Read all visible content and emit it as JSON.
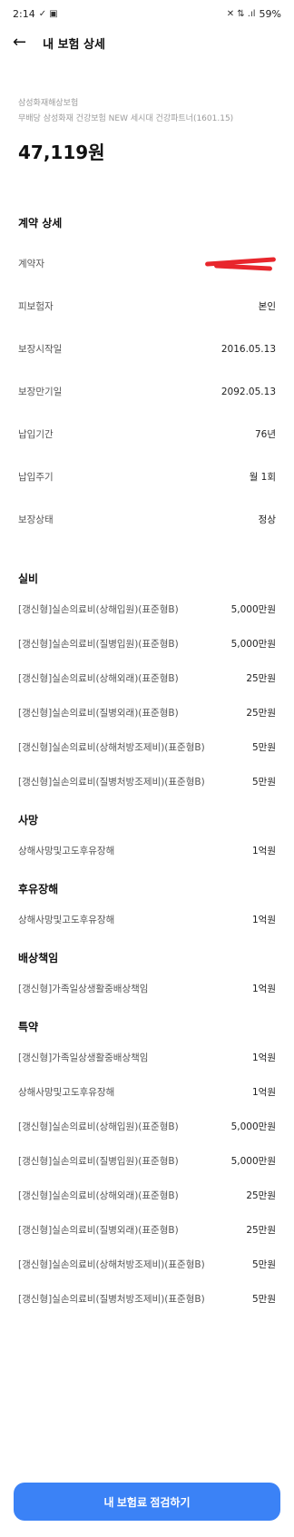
{
  "status_bar": {
    "time": "2:14",
    "battery": "59%"
  },
  "header": {
    "title": "내 보험 상세"
  },
  "product": {
    "company": "삼성화재해상보험",
    "name": "무배당 삼성화재 건강보험 NEW 세시대 건강파트너(1601.15)",
    "premium": "47,119원"
  },
  "contract": {
    "title": "계약 상세",
    "rows": [
      {
        "label": "계약자",
        "value": ""
      },
      {
        "label": "피보험자",
        "value": "본인"
      },
      {
        "label": "보장시작일",
        "value": "2016.05.13"
      },
      {
        "label": "보장만기일",
        "value": "2092.05.13"
      },
      {
        "label": "납입기간",
        "value": "76년"
      },
      {
        "label": "납입주기",
        "value": "월 1회"
      },
      {
        "label": "보장상태",
        "value": "정상"
      }
    ]
  },
  "sections": [
    {
      "title": "실비",
      "rows": [
        {
          "label": "[갱신형]실손의료비(상해입원)(표준형B)",
          "value": "5,000만원"
        },
        {
          "label": "[갱신형]실손의료비(질병입원)(표준형B)",
          "value": "5,000만원"
        },
        {
          "label": "[갱신형]실손의료비(상해외래)(표준형B)",
          "value": "25만원"
        },
        {
          "label": "[갱신형]실손의료비(질병외래)(표준형B)",
          "value": "25만원"
        },
        {
          "label": "[갱신형]실손의료비(상해처방조제비)(표준형B)",
          "value": "5만원"
        },
        {
          "label": "[갱신형]실손의료비(질병처방조제비)(표준형B)",
          "value": "5만원"
        }
      ]
    },
    {
      "title": "사망",
      "rows": [
        {
          "label": "상해사망및고도후유장해",
          "value": "1억원"
        }
      ]
    },
    {
      "title": "후유장해",
      "rows": [
        {
          "label": "상해사망및고도후유장해",
          "value": "1억원"
        }
      ]
    },
    {
      "title": "배상책임",
      "rows": [
        {
          "label": "[갱신형]가족일상생활중배상책임",
          "value": "1억원"
        }
      ]
    },
    {
      "title": "특약",
      "rows": [
        {
          "label": "[갱신형]가족일상생활중배상책임",
          "value": "1억원"
        },
        {
          "label": "상해사망및고도후유장해",
          "value": "1억원"
        },
        {
          "label": "[갱신형]실손의료비(상해입원)(표준형B)",
          "value": "5,000만원"
        },
        {
          "label": "[갱신형]실손의료비(질병입원)(표준형B)",
          "value": "5,000만원"
        },
        {
          "label": "[갱신형]실손의료비(상해외래)(표준형B)",
          "value": "25만원"
        },
        {
          "label": "[갱신형]실손의료비(질병외래)(표준형B)",
          "value": "25만원"
        },
        {
          "label": "[갱신형]실손의료비(상해처방조제비)(표준형B)",
          "value": "5만원"
        },
        {
          "label": "[갱신형]실손의료비(질병처방조제비)(표준형B)",
          "value": "5만원"
        }
      ]
    }
  ],
  "cta": {
    "label": "내 보험료 점검하기"
  },
  "colors": {
    "accent": "#3b82f6",
    "redaction": "#e8262c"
  }
}
